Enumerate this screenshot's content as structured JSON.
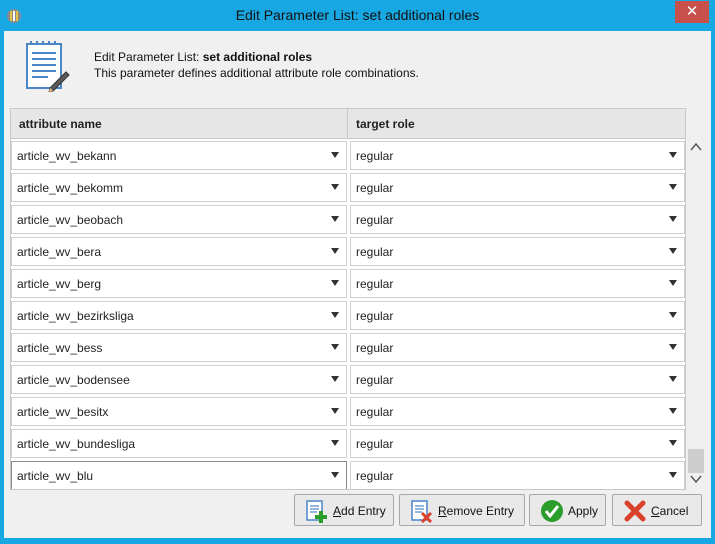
{
  "window": {
    "title": "Edit Parameter List: set additional roles",
    "close_glyph": "✕"
  },
  "header": {
    "line1_prefix": "Edit Parameter List: ",
    "line1_bold": "set additional roles",
    "line2": "This parameter defines additional attribute role combinations."
  },
  "table": {
    "col_headers": [
      "attribute name",
      "target role"
    ],
    "rows": [
      {
        "attribute": "article_wv_bekann",
        "role": "regular"
      },
      {
        "attribute": "article_wv_bekomm",
        "role": "regular"
      },
      {
        "attribute": "article_wv_beobach",
        "role": "regular"
      },
      {
        "attribute": "article_wv_bera",
        "role": "regular"
      },
      {
        "attribute": "article_wv_berg",
        "role": "regular"
      },
      {
        "attribute": "article_wv_bezirksliga",
        "role": "regular"
      },
      {
        "attribute": "article_wv_bess",
        "role": "regular"
      },
      {
        "attribute": "article_wv_bodensee",
        "role": "regular"
      },
      {
        "attribute": "article_wv_besitx",
        "role": "regular"
      },
      {
        "attribute": "article_wv_bundesliga",
        "role": "regular"
      },
      {
        "attribute": "article_wv_blu",
        "role": "regular"
      }
    ]
  },
  "buttons": {
    "add": {
      "mnemonic": "A",
      "rest": "dd Entry",
      "icon": "add-entry-icon"
    },
    "remove": {
      "mnemonic": "R",
      "rest": "emove Entry",
      "icon": "remove-entry-icon"
    },
    "apply": {
      "label": "Apply",
      "icon": "checkmark-icon"
    },
    "cancel": {
      "mnemonic": "C",
      "rest": "ancel",
      "icon": "red-x-icon"
    }
  },
  "colors": {
    "titlebar": "#17a8e3",
    "close_button": "#c7504a",
    "dialog_bg": "#f0f0f0",
    "apply_green": "#2a9d2a",
    "cancel_red": "#d9412b"
  }
}
